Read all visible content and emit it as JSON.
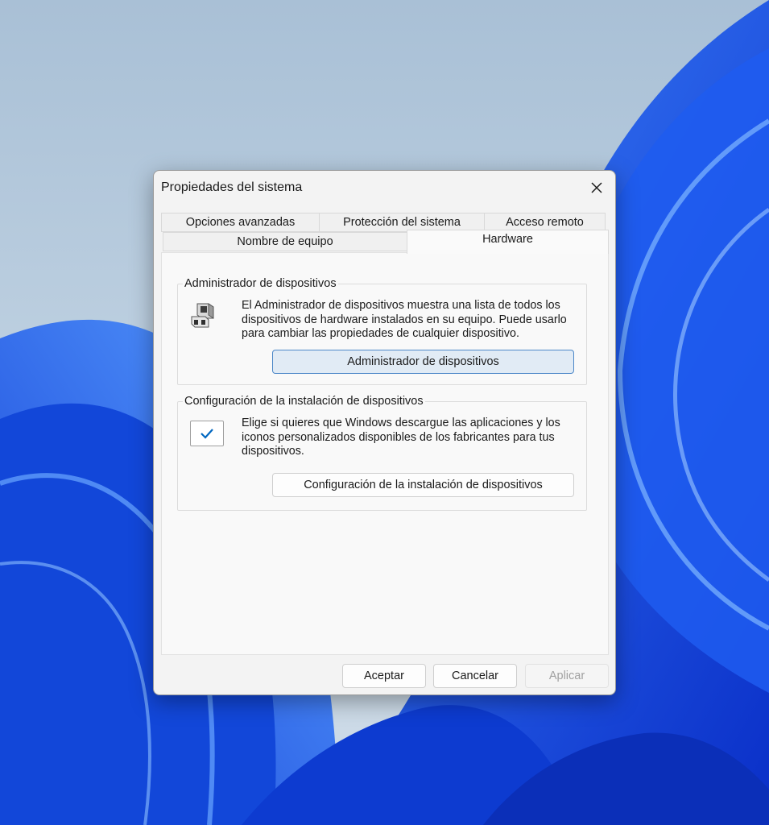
{
  "dialog": {
    "title": "Propiedades del sistema",
    "tabs_row1": [
      "Opciones avanzadas",
      "Protección del sistema",
      "Acceso remoto"
    ],
    "tabs_row2": [
      "Nombre de equipo",
      "Hardware"
    ],
    "active_tab": "Hardware"
  },
  "device_manager": {
    "title": "Administrador de dispositivos",
    "text": "El Administrador de dispositivos muestra una lista de todos los dispositivos de hardware instalados en su equipo. Puede usarlo para cambiar las propiedades de cualquier dispositivo.",
    "button": "Administrador de dispositivos"
  },
  "install_settings": {
    "title": "Configuración de la instalación de dispositivos",
    "text": "Elige si quieres que Windows descargue las aplicaciones y los iconos personalizados disponibles de los fabricantes para tus dispositivos.",
    "button": "Configuración de la instalación de dispositivos"
  },
  "footer": {
    "ok": "Aceptar",
    "cancel": "Cancelar",
    "apply": "Aplicar"
  },
  "colors": {
    "accent": "#0067c0",
    "wallpaper_blue": "#1a57e8"
  }
}
